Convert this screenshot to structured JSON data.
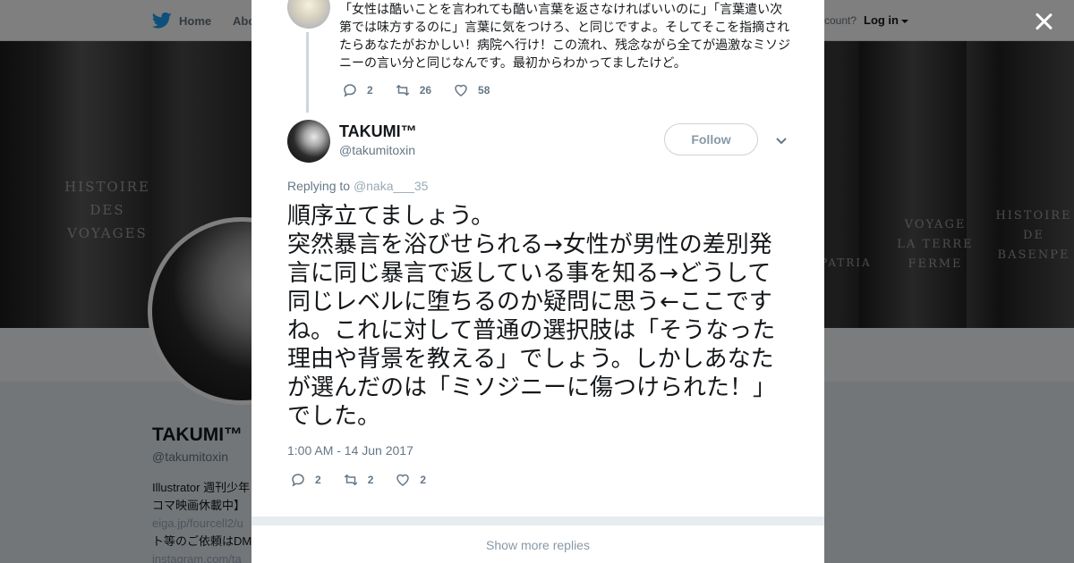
{
  "topbar": {
    "home_label": "Home",
    "about_label": "Abo",
    "account_text": "ccount?",
    "login_label": "Log in"
  },
  "header": {
    "book_spines": [
      {
        "text": "HISTOIRE\nDES\nVOYAGES"
      },
      {
        "text": "VOYAGE\nLA TERRE\nFERME"
      },
      {
        "text": "HISTOIRE\nDE\nBASENPE"
      },
      {
        "text": "PATRIA"
      }
    ]
  },
  "profile": {
    "name": "TAKUMI™",
    "handle": "@takumitoxin",
    "bio_line1": "Illustrator 週刊少年",
    "bio_line2": "コマ映画休載中】",
    "bio_line3": "eiga.jp/fourcell2/u",
    "bio_line4": "ト等のご依頼はDM",
    "bio_line5": "instagram.com/ta"
  },
  "modal": {
    "context_tweet": {
      "text": "「女性は酷いことを言われても酷い言葉を返さなければいいのに」「言葉遣い次第では味方するのに」言葉に気をつけろ、と同じですよ。そしてそこを指摘されたらあなたがおかしい！病院へ行け！この流れ、残念ながら全てが過激なミソジニーの言い分と同じなんです。最初からわかってましたけど。",
      "reply_count": "2",
      "retweet_count": "26",
      "like_count": "58"
    },
    "main_tweet": {
      "name": "TAKUMI™",
      "handle": "@takumitoxin",
      "follow_label": "Follow",
      "replying_prefix": "Replying to",
      "replying_to": "@naka___35",
      "text": "順序立てましょう。\n突然暴言を浴びせられる→女性が男性の差別発言に同じ暴言で返している事を知る→どうして同じレベルに堕ちるのか疑問に思う←ここですね。これに対して普通の選択肢は「そうなった理由や背景を教える」でしょう。しかしあなたが選んだのは「ミソジニーに傷つけられた！」でした。",
      "timestamp": "1:00 AM - 14 Jun 2017",
      "reply_count": "2",
      "retweet_count": "2",
      "like_count": "2"
    },
    "show_more_label": "Show more replies"
  },
  "colors": {
    "brand_blue": "#1da1f2",
    "text_muted": "#657786",
    "overlay": "rgba(0,0,0,0.5)"
  }
}
